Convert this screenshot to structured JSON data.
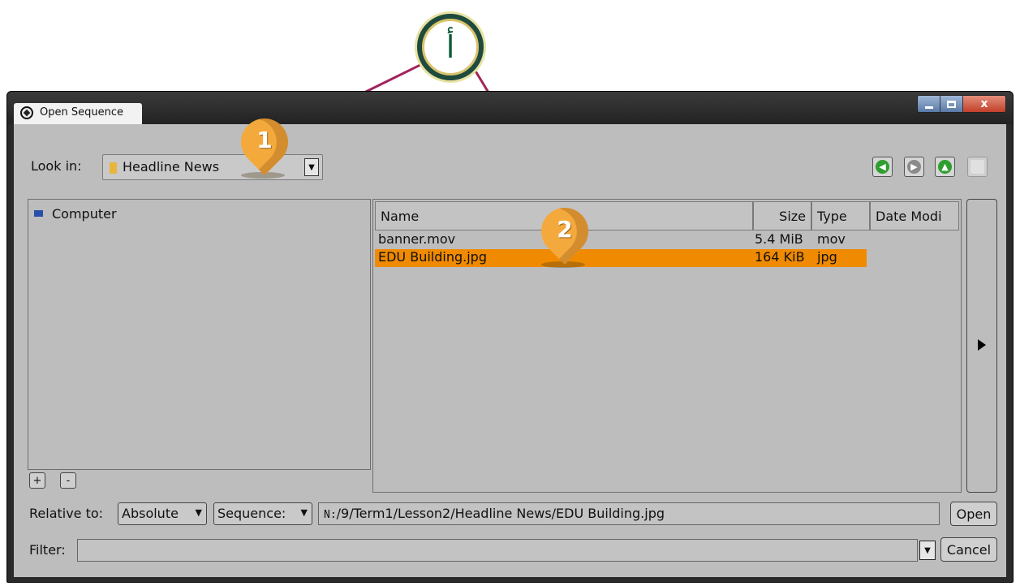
{
  "window": {
    "title": "Open Sequence",
    "controls": {
      "minimize": "minimize",
      "maximize": "maximize",
      "close": "x"
    }
  },
  "look_in": {
    "label": "Look in:",
    "value": "Headline News",
    "icon": "folder-icon"
  },
  "nav_buttons": [
    {
      "name": "back-icon",
      "glyph": "‹",
      "color": "#2f9e2f",
      "enabled": true
    },
    {
      "name": "forward-icon",
      "glyph": "›",
      "color": "#7a7a7a",
      "enabled": true
    },
    {
      "name": "up-folder-icon",
      "glyph": "↑",
      "color": "#2f9e2f",
      "enabled": true
    },
    {
      "name": "new-folder-icon",
      "glyph": "",
      "color": "#d9d9d9",
      "enabled": false
    }
  ],
  "sidebar": {
    "items": [
      {
        "label": "Computer",
        "icon": "computer-icon"
      }
    ],
    "add_label": "+",
    "remove_label": "-"
  },
  "file_list": {
    "columns": [
      "Name",
      "Size",
      "Type",
      "Date Modi"
    ],
    "rows": [
      {
        "name": "banner.mov",
        "size": "5.4 MiB",
        "type": "mov",
        "selected": false
      },
      {
        "name": "EDU Building.jpg",
        "size": "164 KiB",
        "type": "jpg",
        "selected": true
      }
    ],
    "selection_color": "#f08a00"
  },
  "relative": {
    "label": "Relative to:",
    "mode": "Absolute",
    "anchor": "Sequence:",
    "path": "N:/9/Term1/Lesson2/Headline News/EDU Building.jpg",
    "path_drive": "N:",
    "path_rest": "/9/Term1/Lesson2/Headline News/EDU Building.jpg"
  },
  "filter": {
    "label": "Filter:",
    "value": ""
  },
  "buttons": {
    "open": "Open",
    "cancel": "Cancel"
  },
  "annotations": {
    "badge": "أ",
    "pin1": "1",
    "pin2": "2",
    "line_color": "#a3245a",
    "pin_color": "#f4a93d"
  }
}
